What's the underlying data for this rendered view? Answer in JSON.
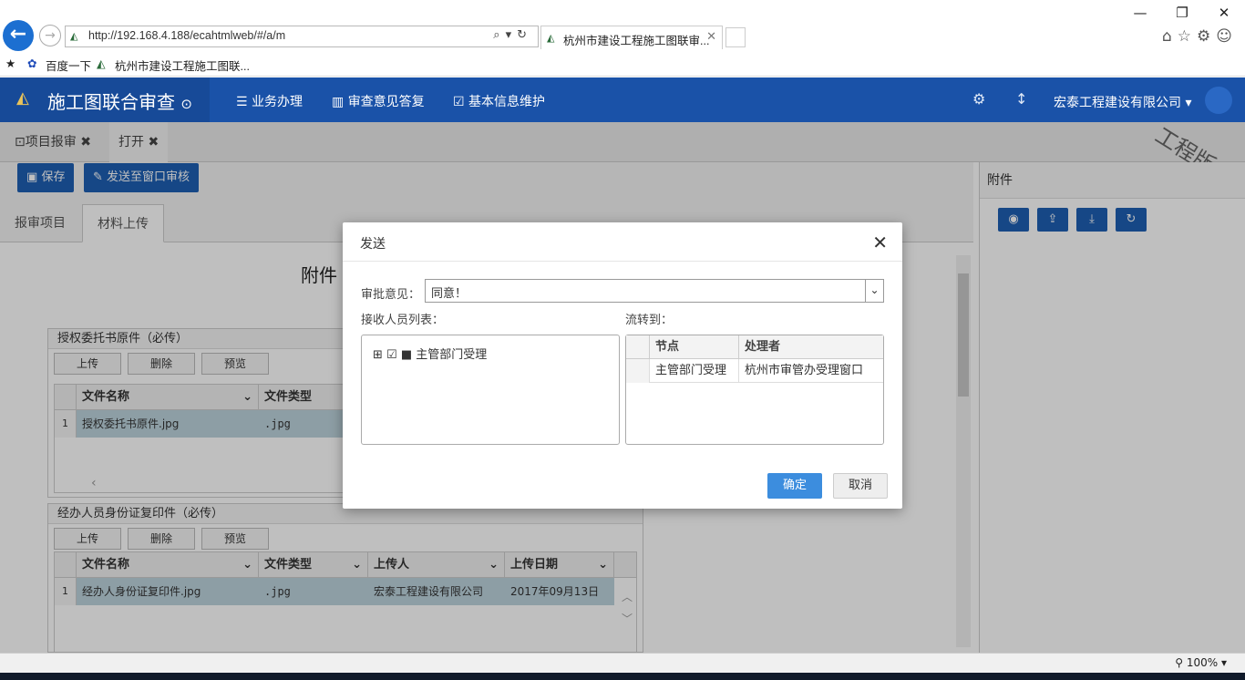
{
  "browser": {
    "url": "http://192.168.4.188/ecahtmlweb/#/a/m",
    "tab_title": "杭州市建设工程施工图联审...",
    "favorites": [
      "百度一下",
      "杭州市建设工程施工图联..."
    ],
    "zoom": "100%"
  },
  "header": {
    "title": "施工图联合审查",
    "nav": [
      "业务办理",
      "审查意见答复",
      "基本信息维护"
    ],
    "company": "宏泰工程建设有限公司"
  },
  "content_tabs": [
    "项目报审",
    "打开"
  ],
  "watermark": "工程版本",
  "toolbar": {
    "save": "保存",
    "send": "发送至窗口审核"
  },
  "subtabs": [
    "报审项目",
    "材料上传"
  ],
  "main_title": "附件",
  "sections": [
    {
      "title": "授权委托书原件（必传）",
      "buttons": [
        "上传",
        "删除",
        "预览"
      ],
      "columns": [
        "文件名称",
        "文件类型"
      ],
      "rows": [
        {
          "num": "1",
          "name": "授权委托书原件.jpg",
          "type": ".jpg"
        }
      ]
    },
    {
      "title": "经办人员身份证复印件（必传）",
      "buttons": [
        "上传",
        "删除",
        "预览"
      ],
      "columns": [
        "文件名称",
        "文件类型",
        "上传人",
        "上传日期"
      ],
      "rows": [
        {
          "num": "1",
          "name": "经办人身份证复印件.jpg",
          "type": ".jpg",
          "uploader": "宏泰工程建设有限公司",
          "date": "2017年09月13日"
        }
      ]
    }
  ],
  "right_panel": {
    "title": "附件"
  },
  "dialog": {
    "title": "发送",
    "opinion_label": "审批意见：",
    "opinion_value": "同意！",
    "recipients_label": "接收人员列表：",
    "flow_label": "流转到：",
    "tree_node": "主管部门受理",
    "flow_columns": [
      "节点",
      "处理者"
    ],
    "flow_rows": [
      {
        "node": "主管部门受理",
        "handler": "杭州市审管办受理窗口"
      }
    ],
    "ok": "确定",
    "cancel": "取消"
  }
}
